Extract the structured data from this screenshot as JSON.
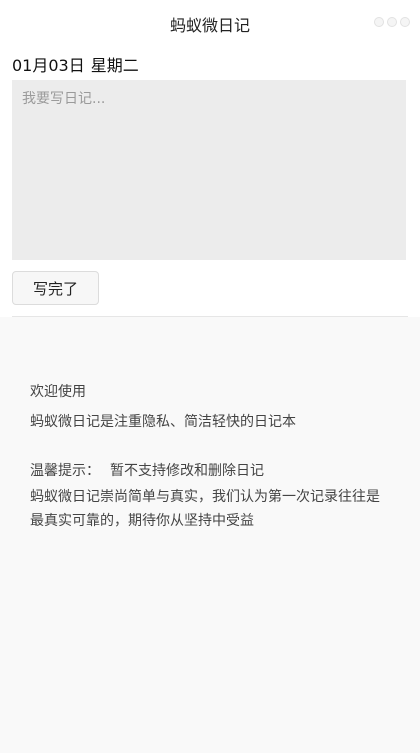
{
  "header": {
    "title": "蚂蚁微日记",
    "menu_icon": "more-dots-icon"
  },
  "entry": {
    "date": "01月03日",
    "weekday": "星期二",
    "placeholder": "我要写日记...",
    "value": "",
    "submit_label": "写完了"
  },
  "info": {
    "welcome_heading": "欢迎使用",
    "welcome_text": "蚂蚁微日记是注重隐私、简洁轻快的日记本",
    "tip_label": "温馨提示：",
    "tip_text": "暂不支持修改和删除日记",
    "philosophy_text": "蚂蚁微日记崇尚简单与真实，我们认为第一次记录往往是最真实可靠的，期待你从坚持中受益"
  },
  "colors": {
    "input_background": "#ececec",
    "panel_background": "#f9f9f9",
    "button_background": "#f7f7f7"
  }
}
